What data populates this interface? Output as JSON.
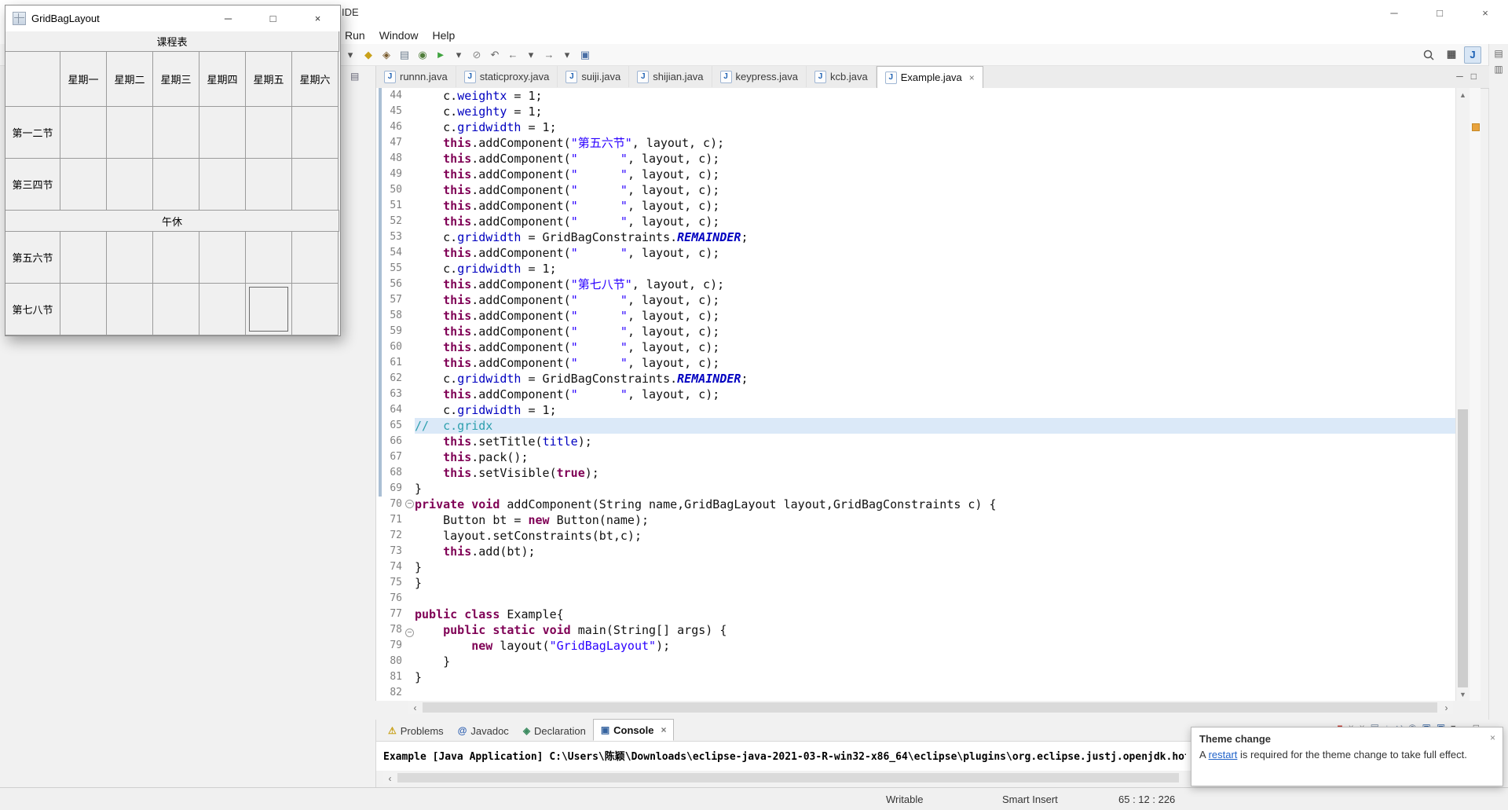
{
  "icons": {
    "minimize": "─",
    "maximize": "□",
    "close": "×",
    "scroll_up": "▲",
    "scroll_down": "▼",
    "scroll_left": "‹",
    "scroll_right": "›",
    "dropdown": "▾",
    "fold": "−",
    "java_file": "J",
    "view_menu": "▤"
  },
  "colors": {
    "keyword": "#7f0055",
    "string": "#2a00ff",
    "field": "#0000c0",
    "static_field": "#0000c0",
    "comment": "#2d9fae",
    "current_line_bg": "#dbe9f8",
    "link": "#1f62c9",
    "occurrence_marker": "#e8a33d"
  },
  "eclipse": {
    "title": "IDE",
    "window_controls": [
      {
        "name": "minimize-window-button",
        "icon": "minimize"
      },
      {
        "name": "maximize-window-button",
        "icon": "maximize"
      },
      {
        "name": "close-window-button",
        "icon": "close"
      }
    ],
    "menubar": [
      "Run",
      "Window",
      "Help"
    ],
    "toolbar_icons": [
      {
        "name": "new-wizard-dropdown-icon",
        "glyph": "▾",
        "color": "#555555"
      },
      {
        "name": "mark-occurrences-icon",
        "glyph": "◆",
        "color": "#c9a11a"
      },
      {
        "name": "open-type-icon",
        "glyph": "◈",
        "color": "#7a5c2e"
      },
      {
        "name": "print-icon",
        "glyph": "▤",
        "color": "#6b7b8c"
      },
      {
        "name": "debug-icon",
        "glyph": "◉",
        "color": "#4f7d3a"
      },
      {
        "name": "run-icon",
        "glyph": "►",
        "color": "#3fa33f"
      },
      {
        "name": "run-dropdown-icon",
        "glyph": "▾",
        "color": "#555555"
      },
      {
        "name": "skip-breakpoints-icon",
        "glyph": "⊘",
        "color": "#888888"
      },
      {
        "name": "last-edit-location-icon",
        "glyph": "↶",
        "color": "#666666"
      },
      {
        "name": "back-icon",
        "glyph": "←",
        "color": "#666666"
      },
      {
        "name": "back-dropdown-icon",
        "glyph": "▾",
        "color": "#555555"
      },
      {
        "name": "forward-icon",
        "glyph": "→",
        "color": "#666666"
      },
      {
        "name": "forward-dropdown-icon",
        "glyph": "▾",
        "color": "#555555"
      },
      {
        "name": "link-with-editor-icon",
        "glyph": "▣",
        "color": "#4a6fa5"
      }
    ],
    "perspective_icons": [
      {
        "name": "open-perspective-icon",
        "glyph": "▦",
        "color": "#555555",
        "active": false
      },
      {
        "name": "java-perspective-icon",
        "glyph": "J",
        "color": "#1a5fb4",
        "active": true
      }
    ],
    "right_strip_icons": [
      {
        "name": "package-explorer-restore-icon",
        "glyph": "▤"
      },
      {
        "name": "outline-restore-icon",
        "glyph": "▥"
      }
    ],
    "tabbar_icons": [
      {
        "name": "minimize-editor-icon",
        "icon": "minimize"
      },
      {
        "name": "maximize-editor-icon",
        "icon": "maximize"
      }
    ]
  },
  "editor_tabs": [
    {
      "label": "runnn.java",
      "active": false
    },
    {
      "label": "staticproxy.java",
      "active": false
    },
    {
      "label": "suiji.java",
      "active": false
    },
    {
      "label": "shijian.java",
      "active": false
    },
    {
      "label": "keypress.java",
      "active": false
    },
    {
      "label": "kcb.java",
      "active": false
    },
    {
      "label": "Example.java",
      "active": true
    }
  ],
  "editor": {
    "current_line": 65,
    "lines": [
      {
        "n": 44,
        "seg": [
          [
            "d",
            "    c."
          ],
          [
            "f",
            "weightx"
          ],
          [
            "d",
            " = 1;"
          ]
        ]
      },
      {
        "n": 45,
        "seg": [
          [
            "d",
            "    c."
          ],
          [
            "f",
            "weighty"
          ],
          [
            "d",
            " = 1;"
          ]
        ]
      },
      {
        "n": 46,
        "seg": [
          [
            "d",
            "    c."
          ],
          [
            "f",
            "gridwidth"
          ],
          [
            "d",
            " = 1;"
          ]
        ]
      },
      {
        "n": 47,
        "seg": [
          [
            "d",
            "    "
          ],
          [
            "k",
            "this"
          ],
          [
            "d",
            ".addComponent("
          ],
          [
            "s",
            "\"第五六节\""
          ],
          [
            "d",
            ", layout, c);"
          ]
        ]
      },
      {
        "n": 48,
        "seg": [
          [
            "d",
            "    "
          ],
          [
            "k",
            "this"
          ],
          [
            "d",
            ".addComponent("
          ],
          [
            "s",
            "\"      \""
          ],
          [
            "d",
            ", layout, c);"
          ]
        ]
      },
      {
        "n": 49,
        "seg": [
          [
            "d",
            "    "
          ],
          [
            "k",
            "this"
          ],
          [
            "d",
            ".addComponent("
          ],
          [
            "s",
            "\"      \""
          ],
          [
            "d",
            ", layout, c);"
          ]
        ]
      },
      {
        "n": 50,
        "seg": [
          [
            "d",
            "    "
          ],
          [
            "k",
            "this"
          ],
          [
            "d",
            ".addComponent("
          ],
          [
            "s",
            "\"      \""
          ],
          [
            "d",
            ", layout, c);"
          ]
        ]
      },
      {
        "n": 51,
        "seg": [
          [
            "d",
            "    "
          ],
          [
            "k",
            "this"
          ],
          [
            "d",
            ".addComponent("
          ],
          [
            "s",
            "\"      \""
          ],
          [
            "d",
            ", layout, c);"
          ]
        ]
      },
      {
        "n": 52,
        "seg": [
          [
            "d",
            "    "
          ],
          [
            "k",
            "this"
          ],
          [
            "d",
            ".addComponent("
          ],
          [
            "s",
            "\"      \""
          ],
          [
            "d",
            ", layout, c);"
          ]
        ]
      },
      {
        "n": 53,
        "seg": [
          [
            "d",
            "    c."
          ],
          [
            "f",
            "gridwidth"
          ],
          [
            "d",
            " = GridBagConstraints."
          ],
          [
            "r",
            "REMAINDER"
          ],
          [
            "d",
            ";"
          ]
        ]
      },
      {
        "n": 54,
        "seg": [
          [
            "d",
            "    "
          ],
          [
            "k",
            "this"
          ],
          [
            "d",
            ".addComponent("
          ],
          [
            "s",
            "\"      \""
          ],
          [
            "d",
            ", layout, c);"
          ]
        ]
      },
      {
        "n": 55,
        "seg": [
          [
            "d",
            "    c."
          ],
          [
            "f",
            "gridwidth"
          ],
          [
            "d",
            " = 1;"
          ]
        ]
      },
      {
        "n": 56,
        "seg": [
          [
            "d",
            "    "
          ],
          [
            "k",
            "this"
          ],
          [
            "d",
            ".addComponent("
          ],
          [
            "s",
            "\"第七八节\""
          ],
          [
            "d",
            ", layout, c);"
          ]
        ]
      },
      {
        "n": 57,
        "seg": [
          [
            "d",
            "    "
          ],
          [
            "k",
            "this"
          ],
          [
            "d",
            ".addComponent("
          ],
          [
            "s",
            "\"      \""
          ],
          [
            "d",
            ", layout, c);"
          ]
        ]
      },
      {
        "n": 58,
        "seg": [
          [
            "d",
            "    "
          ],
          [
            "k",
            "this"
          ],
          [
            "d",
            ".addComponent("
          ],
          [
            "s",
            "\"      \""
          ],
          [
            "d",
            ", layout, c);"
          ]
        ]
      },
      {
        "n": 59,
        "seg": [
          [
            "d",
            "    "
          ],
          [
            "k",
            "this"
          ],
          [
            "d",
            ".addComponent("
          ],
          [
            "s",
            "\"      \""
          ],
          [
            "d",
            ", layout, c);"
          ]
        ]
      },
      {
        "n": 60,
        "seg": [
          [
            "d",
            "    "
          ],
          [
            "k",
            "this"
          ],
          [
            "d",
            ".addComponent("
          ],
          [
            "s",
            "\"      \""
          ],
          [
            "d",
            ", layout, c);"
          ]
        ]
      },
      {
        "n": 61,
        "seg": [
          [
            "d",
            "    "
          ],
          [
            "k",
            "this"
          ],
          [
            "d",
            ".addComponent("
          ],
          [
            "s",
            "\"      \""
          ],
          [
            "d",
            ", layout, c);"
          ]
        ]
      },
      {
        "n": 62,
        "seg": [
          [
            "d",
            "    c."
          ],
          [
            "f",
            "gridwidth"
          ],
          [
            "d",
            " = GridBagConstraints."
          ],
          [
            "r",
            "REMAINDER"
          ],
          [
            "d",
            ";"
          ]
        ]
      },
      {
        "n": 63,
        "seg": [
          [
            "d",
            "    "
          ],
          [
            "k",
            "this"
          ],
          [
            "d",
            ".addComponent("
          ],
          [
            "s",
            "\"      \""
          ],
          [
            "d",
            ", layout, c);"
          ]
        ]
      },
      {
        "n": 64,
        "seg": [
          [
            "d",
            "    c."
          ],
          [
            "f",
            "gridwidth"
          ],
          [
            "d",
            " = 1;"
          ]
        ]
      },
      {
        "n": 65,
        "seg": [
          [
            "c",
            "//  c.gridx"
          ]
        ]
      },
      {
        "n": 66,
        "seg": [
          [
            "d",
            "    "
          ],
          [
            "k",
            "this"
          ],
          [
            "d",
            ".setTitle("
          ],
          [
            "f",
            "title"
          ],
          [
            "d",
            ");"
          ]
        ]
      },
      {
        "n": 67,
        "seg": [
          [
            "d",
            "    "
          ],
          [
            "k",
            "this"
          ],
          [
            "d",
            ".pack();"
          ]
        ]
      },
      {
        "n": 68,
        "seg": [
          [
            "d",
            "    "
          ],
          [
            "k",
            "this"
          ],
          [
            "d",
            ".setVisible("
          ],
          [
            "k",
            "true"
          ],
          [
            "d",
            ");"
          ]
        ]
      },
      {
        "n": 69,
        "seg": [
          [
            "d",
            "}"
          ]
        ]
      },
      {
        "n": 70,
        "fold": true,
        "seg": [
          [
            "k",
            "private"
          ],
          [
            "d",
            " "
          ],
          [
            "k",
            "void"
          ],
          [
            "d",
            " addComponent(String name,GridBagLayout layout,GridBagConstraints c) {"
          ]
        ]
      },
      {
        "n": 71,
        "seg": [
          [
            "d",
            "    Button bt = "
          ],
          [
            "k",
            "new"
          ],
          [
            "d",
            " Button(name);"
          ]
        ]
      },
      {
        "n": 72,
        "seg": [
          [
            "d",
            "    layout.setConstraints(bt,c);"
          ]
        ]
      },
      {
        "n": 73,
        "seg": [
          [
            "d",
            "    "
          ],
          [
            "k",
            "this"
          ],
          [
            "d",
            ".add(bt);"
          ]
        ]
      },
      {
        "n": 74,
        "seg": [
          [
            "d",
            "}"
          ]
        ]
      },
      {
        "n": 75,
        "seg": [
          [
            "d",
            "}"
          ]
        ]
      },
      {
        "n": 76,
        "seg": []
      },
      {
        "n": 77,
        "seg": [
          [
            "k",
            "public"
          ],
          [
            "d",
            " "
          ],
          [
            "k",
            "class"
          ],
          [
            "d",
            " Example{"
          ]
        ]
      },
      {
        "n": 78,
        "fold": true,
        "seg": [
          [
            "d",
            "    "
          ],
          [
            "k",
            "public"
          ],
          [
            "d",
            " "
          ],
          [
            "k",
            "static"
          ],
          [
            "d",
            " "
          ],
          [
            "k",
            "void"
          ],
          [
            "d",
            " main(String[] args) {"
          ]
        ]
      },
      {
        "n": 79,
        "seg": [
          [
            "d",
            "        "
          ],
          [
            "k",
            "new"
          ],
          [
            "d",
            " layout("
          ],
          [
            "s",
            "\"GridBagLayout\""
          ],
          [
            "d",
            ");"
          ]
        ]
      },
      {
        "n": 80,
        "seg": [
          [
            "d",
            "    }"
          ]
        ]
      },
      {
        "n": 81,
        "seg": [
          [
            "d",
            "}"
          ]
        ]
      },
      {
        "n": 82,
        "seg": []
      }
    ]
  },
  "console": {
    "tabs": [
      {
        "label": "Problems",
        "icon_name": "problems-icon",
        "icon_glyph": "⚠",
        "icon_color": "#c9a11a",
        "active": false
      },
      {
        "label": "Javadoc",
        "icon_name": "javadoc-icon",
        "icon_glyph": "@",
        "icon_color": "#2a5db0",
        "active": false
      },
      {
        "label": "Declaration",
        "icon_name": "declaration-icon",
        "icon_glyph": "◈",
        "icon_color": "#3a8a5f",
        "active": false
      },
      {
        "label": "Console",
        "icon_name": "console-icon",
        "icon_glyph": "▣",
        "icon_color": "#35639f",
        "active": true
      }
    ],
    "toolbar_icons": [
      {
        "name": "terminate-icon",
        "glyph": "■",
        "color": "#c24038"
      },
      {
        "name": "remove-launch-icon",
        "glyph": "×",
        "color": "#8a8a8a"
      },
      {
        "name": "remove-all-launches-icon",
        "glyph": "×",
        "color": "#8a8a8a"
      },
      {
        "name": "clear-console-icon",
        "glyph": "▤",
        "color": "#7a8aa0"
      },
      {
        "name": "scroll-lock-icon",
        "glyph": "↓",
        "color": "#7a8aa0"
      },
      {
        "name": "word-wrap-icon",
        "glyph": "↩",
        "color": "#7a8aa0"
      },
      {
        "name": "pin-console-icon",
        "glyph": "◉",
        "color": "#7a8aa0"
      },
      {
        "name": "display-selected-console-icon",
        "glyph": "▣",
        "color": "#35639f"
      },
      {
        "name": "open-console-icon",
        "glyph": "▣",
        "color": "#35639f"
      },
      {
        "name": "open-console-dropdown-icon",
        "glyph": "▾",
        "color": "#555555"
      },
      {
        "name": "minimize-view-icon",
        "glyph": "─",
        "color": "#555555"
      },
      {
        "name": "maximize-view-icon",
        "glyph": "□",
        "color": "#555555"
      }
    ],
    "label": "Example [Java Application] C:\\Users\\陈颖\\Downloads\\eclipse-java-2021-03-R-win32-x86_64\\eclipse\\plugins\\org.eclipse.justj.openjdk.hotspot.jr"
  },
  "statusbar": {
    "writable": "Writable",
    "insert_mode": "Smart Insert",
    "position": "65 : 12 : 226"
  },
  "notification": {
    "title": "Theme change",
    "body_pre": "A ",
    "link_label": "restart",
    "body_post": " is required for the theme change to take full effect."
  },
  "swing": {
    "title": "GridBagLayout",
    "days": [
      "星期一",
      "星期二",
      "星期三",
      "星期四",
      "星期五",
      "星期六"
    ],
    "rows": [
      {
        "kind": "header",
        "label": "课程表"
      },
      {
        "kind": "days"
      },
      {
        "kind": "period",
        "label": "第一二节"
      },
      {
        "kind": "period",
        "label": "第三四节"
      },
      {
        "kind": "lunch",
        "label": "午休"
      },
      {
        "kind": "period",
        "label": "第五六节"
      },
      {
        "kind": "period",
        "label": "第七八节",
        "focus_day_index": 4
      }
    ],
    "window_controls": [
      {
        "name": "minimize-button",
        "icon": "minimize"
      },
      {
        "name": "maximize-button",
        "icon": "maximize"
      },
      {
        "name": "close-button",
        "icon": "close"
      }
    ]
  }
}
